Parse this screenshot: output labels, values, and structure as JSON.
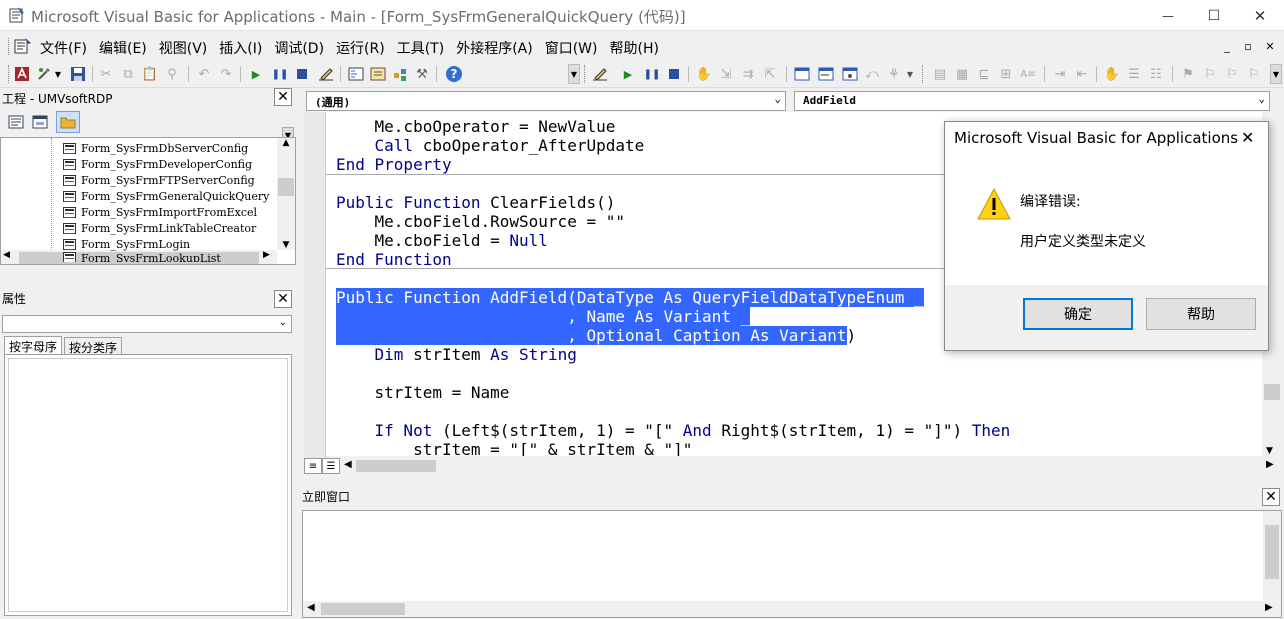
{
  "window": {
    "title": "Microsoft Visual Basic for Applications - Main - [Form_SysFrmGeneralQuickQuery (代码)]",
    "minimize": "—",
    "maximize": "☐",
    "close": "✕"
  },
  "menubar": {
    "items": [
      "文件(F)",
      "编辑(E)",
      "视图(V)",
      "插入(I)",
      "调试(D)",
      "运行(R)",
      "工具(T)",
      "外接程序(A)",
      "窗口(W)",
      "帮助(H)"
    ],
    "mdi_min": "_",
    "mdi_restore": "▫",
    "mdi_close": "✕"
  },
  "project_panel": {
    "title": "工程 - UMVsoftRDP",
    "items": [
      "Form_SysFrmDbServerConfig",
      "Form_SysFrmDeveloperConfig",
      "Form_SysFrmFTPServerConfig",
      "Form_SysFrmGeneralQuickQuery",
      "Form_SysFrmImportFromExcel",
      "Form_SysFrmLinkTableCreator",
      "Form_SysFrmLogin",
      "Form_SysFrmLookupList"
    ]
  },
  "properties_panel": {
    "title": "属性",
    "tab_alpha": "按字母序",
    "tab_category": "按分类序"
  },
  "code_window": {
    "object_combo": "(通用)",
    "procedure_combo": "AddField",
    "lines": [
      {
        "indent": "    ",
        "parts": [
          {
            "t": "Me.cboOperator = NewValue",
            "k": false
          }
        ]
      },
      {
        "indent": "    ",
        "parts": [
          {
            "t": "Call",
            "k": true
          },
          {
            "t": " cboOperator_AfterUpdate",
            "k": false
          }
        ]
      },
      {
        "indent": "",
        "parts": [
          {
            "t": "End Property",
            "k": true
          }
        ]
      },
      {
        "indent": "",
        "parts": []
      },
      {
        "indent": "",
        "parts": [
          {
            "t": "Public Function",
            "k": true
          },
          {
            "t": " ClearFields()",
            "k": false
          }
        ]
      },
      {
        "indent": "    ",
        "parts": [
          {
            "t": "Me.cboField.RowSource = \"\"",
            "k": false
          }
        ]
      },
      {
        "indent": "    ",
        "parts": [
          {
            "t": "Me.cboField = ",
            "k": false
          },
          {
            "t": "Null",
            "k": true
          }
        ]
      },
      {
        "indent": "",
        "parts": [
          {
            "t": "End Function",
            "k": true
          }
        ]
      },
      {
        "indent": "",
        "parts": []
      },
      {
        "indent": "",
        "parts": [
          {
            "t": "Public Function AddField(DataType As QueryFieldDataTypeEnum _",
            "s": true
          }
        ]
      },
      {
        "indent": "",
        "parts": [
          {
            "t": "                        , Name As Variant _",
            "s": true
          }
        ]
      },
      {
        "indent": "",
        "parts": [
          {
            "t": "                        , Optional Caption As Variant",
            "s": true
          },
          {
            "t": ")",
            "k": false
          }
        ]
      },
      {
        "indent": "    ",
        "parts": [
          {
            "t": "Dim",
            "k": true
          },
          {
            "t": " strItem ",
            "k": false
          },
          {
            "t": "As String",
            "k": true
          }
        ]
      },
      {
        "indent": "",
        "parts": []
      },
      {
        "indent": "    ",
        "parts": [
          {
            "t": "strItem = Name",
            "k": false
          }
        ]
      },
      {
        "indent": "",
        "parts": []
      },
      {
        "indent": "    ",
        "parts": [
          {
            "t": "If Not",
            "k": true
          },
          {
            "t": " (Left$(strItem, 1) = \"[\" ",
            "k": false
          },
          {
            "t": "And",
            "k": true
          },
          {
            "t": " Right$(strItem, 1) = \"]\") ",
            "k": false
          },
          {
            "t": "Then",
            "k": true
          }
        ]
      },
      {
        "indent": "        ",
        "parts": [
          {
            "t": "strItem = \"[\" & strItem & \"]\"",
            "k": false
          }
        ]
      }
    ]
  },
  "immediate_window": {
    "title": "立即窗口"
  },
  "dialog": {
    "title": "Microsoft Visual Basic for Applications",
    "heading": "编译错误:",
    "message": "用户定义类型未定义",
    "ok_label": "确定",
    "help_label": "帮助",
    "icon": "warning-icon"
  }
}
